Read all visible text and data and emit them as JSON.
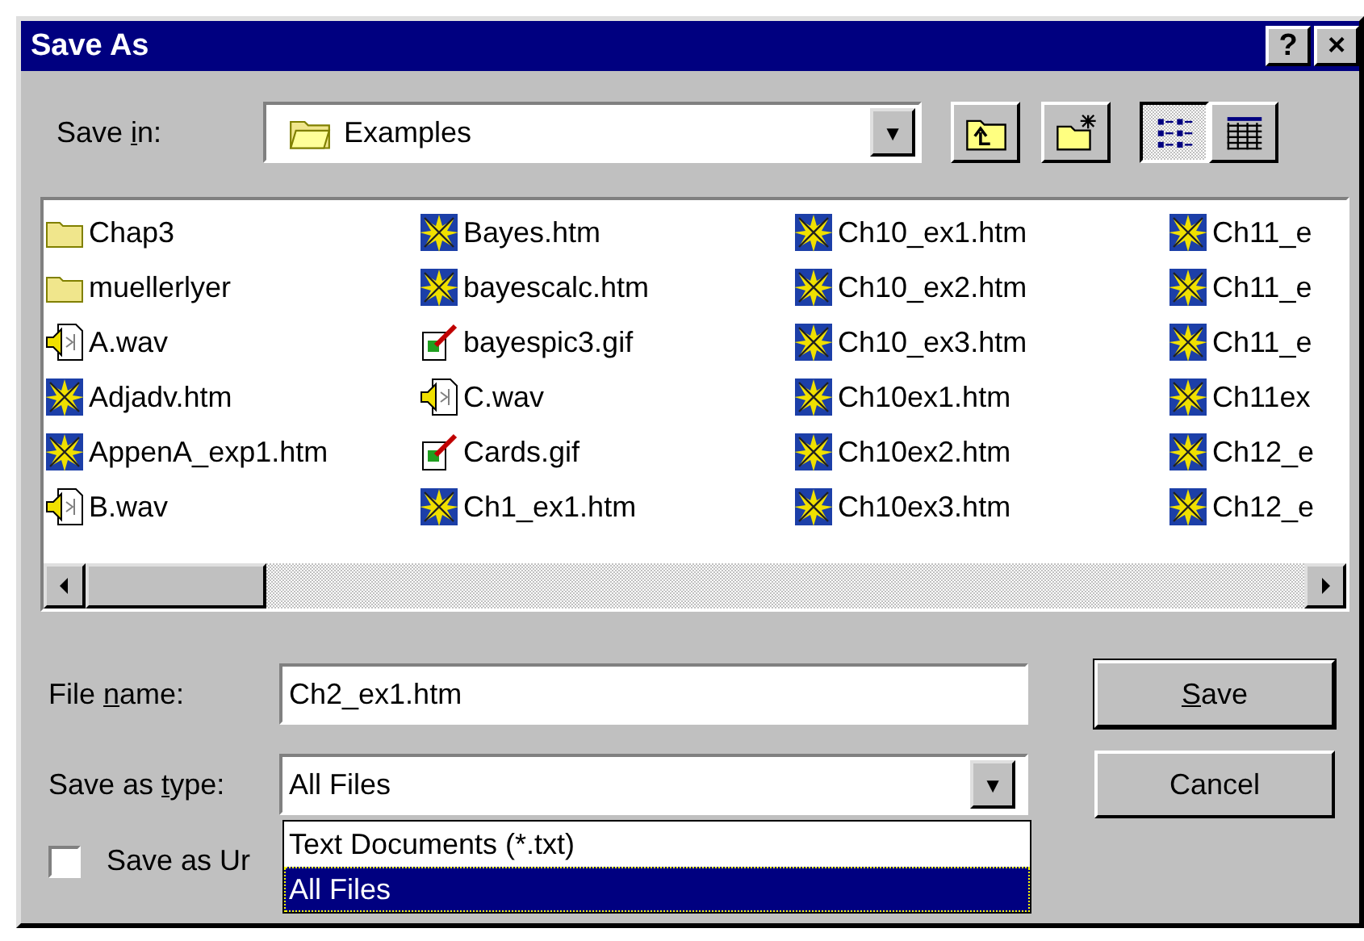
{
  "window": {
    "title": "Save As",
    "help_button": "?",
    "close_button": "×"
  },
  "save_in": {
    "label": {
      "before": "Save ",
      "key": "i",
      "after": "n:"
    },
    "value": "Examples",
    "arrow": "▼"
  },
  "toolbar": [
    {
      "kind": "up_folder",
      "pressed": false
    },
    {
      "kind": "new_folder",
      "pressed": false
    },
    {
      "kind": "list_view",
      "pressed": true
    },
    {
      "kind": "details_view",
      "pressed": false
    }
  ],
  "files": [
    {
      "name": "Chap3",
      "kind": "folder"
    },
    {
      "name": "muellerlyer",
      "kind": "folder"
    },
    {
      "name": "A.wav",
      "kind": "wav"
    },
    {
      "name": "Adjadv.htm",
      "kind": "htm"
    },
    {
      "name": "AppenA_exp1.htm",
      "kind": "htm"
    },
    {
      "name": "B.wav",
      "kind": "wav"
    },
    {
      "name": "Bayes.htm",
      "kind": "htm"
    },
    {
      "name": "bayescalc.htm",
      "kind": "htm"
    },
    {
      "name": "bayespic3.gif",
      "kind": "gif"
    },
    {
      "name": "C.wav",
      "kind": "wav"
    },
    {
      "name": "Cards.gif",
      "kind": "gif"
    },
    {
      "name": "Ch1_ex1.htm",
      "kind": "htm"
    },
    {
      "name": "Ch10_ex1.htm",
      "kind": "htm"
    },
    {
      "name": "Ch10_ex2.htm",
      "kind": "htm"
    },
    {
      "name": "Ch10_ex3.htm",
      "kind": "htm"
    },
    {
      "name": "Ch10ex1.htm",
      "kind": "htm"
    },
    {
      "name": "Ch10ex2.htm",
      "kind": "htm"
    },
    {
      "name": "Ch10ex3.htm",
      "kind": "htm"
    },
    {
      "name": "Ch11_e",
      "kind": "htm"
    },
    {
      "name": "Ch11_e",
      "kind": "htm"
    },
    {
      "name": "Ch11_e",
      "kind": "htm"
    },
    {
      "name": "Ch11ex",
      "kind": "htm"
    },
    {
      "name": "Ch12_e",
      "kind": "htm"
    },
    {
      "name": "Ch12_e",
      "kind": "htm"
    }
  ],
  "file_name": {
    "label": {
      "before": "File ",
      "key": "n",
      "after": "ame:"
    },
    "value": "Ch2_ex1.htm"
  },
  "save_as_type": {
    "label": {
      "before": "Save as ",
      "key": "t",
      "after": "ype:"
    },
    "value": "All Files",
    "arrow": "▼",
    "options": [
      {
        "label": "Text Documents (*.txt)",
        "selected": false
      },
      {
        "label": "All Files",
        "selected": true
      }
    ]
  },
  "buttons": [
    {
      "key": "S",
      "after": "ave"
    },
    {
      "before": "Cancel"
    }
  ],
  "unicode_checkbox": {
    "label": "Save as Ur",
    "checked": false
  }
}
